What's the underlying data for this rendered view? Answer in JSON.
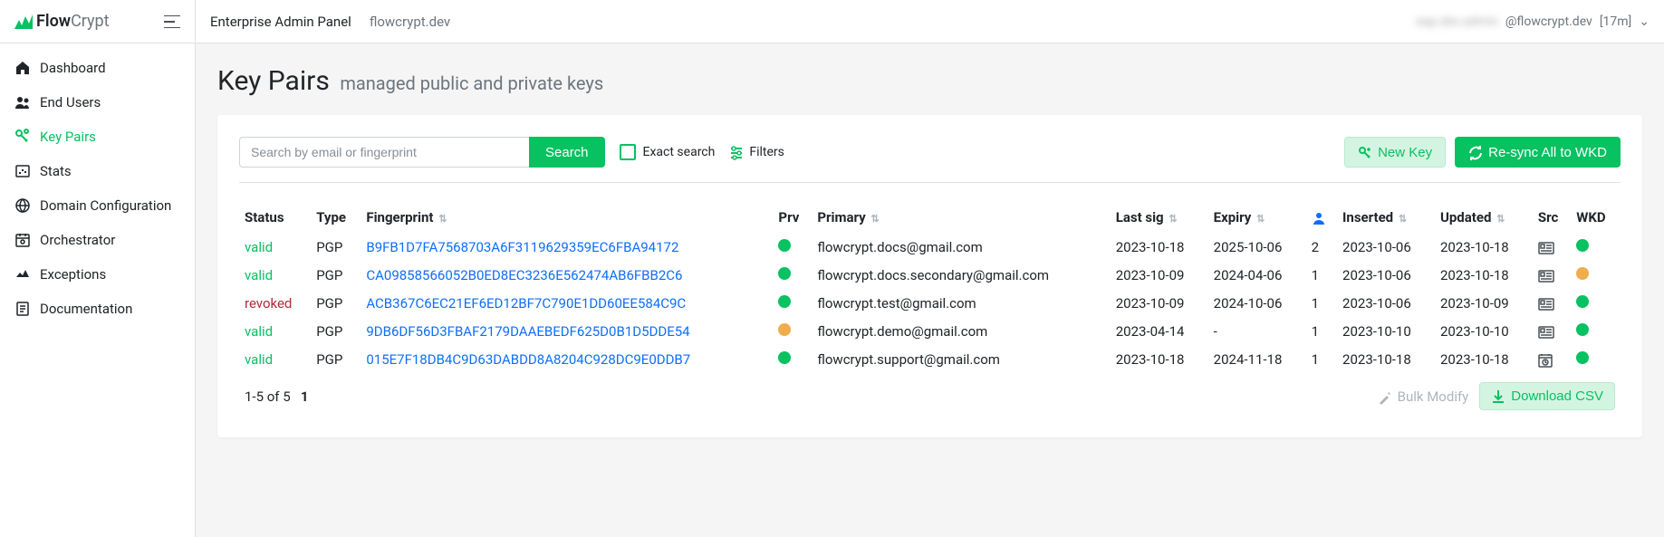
{
  "logo": {
    "flow": "Flow",
    "crypt": "Crypt"
  },
  "topbar": {
    "title": "Enterprise Admin Panel",
    "domain": "flowcrypt.dev",
    "user_prefix": "eap.dev.admin",
    "user_domain": "@flowcrypt.dev",
    "session": "[17m]"
  },
  "sidebar": {
    "items": [
      {
        "label": "Dashboard",
        "icon": "home"
      },
      {
        "label": "End Users",
        "icon": "users"
      },
      {
        "label": "Key Pairs",
        "icon": "keys",
        "active": true
      },
      {
        "label": "Stats",
        "icon": "stats"
      },
      {
        "label": "Domain Configuration",
        "icon": "globe"
      },
      {
        "label": "Orchestrator",
        "icon": "calendar"
      },
      {
        "label": "Exceptions",
        "icon": "exception"
      },
      {
        "label": "Documentation",
        "icon": "doc"
      }
    ]
  },
  "page": {
    "title": "Key Pairs",
    "subtitle": "managed public and private keys"
  },
  "toolbar": {
    "search_placeholder": "Search by email or fingerprint",
    "search_btn": "Search",
    "exact_search": "Exact search",
    "filters": "Filters",
    "new_key": "New Key",
    "resync": "Re-sync All to WKD"
  },
  "table": {
    "headers": {
      "status": "Status",
      "type": "Type",
      "fingerprint": "Fingerprint",
      "prv": "Prv",
      "primary": "Primary",
      "last_sig": "Last sig",
      "expiry": "Expiry",
      "person": "",
      "inserted": "Inserted",
      "updated": "Updated",
      "src": "Src",
      "wkd": "WKD"
    },
    "rows": [
      {
        "status": "valid",
        "status_class": "valid",
        "type": "PGP",
        "fingerprint": "B9FB1D7FA7568703A6F3119629359EC6FBA94172",
        "prv": "green",
        "primary": "flowcrypt.docs@gmail.com",
        "last_sig": "2023-10-18",
        "expiry": "2025-10-06",
        "person": "2",
        "inserted": "2023-10-06",
        "updated": "2023-10-18",
        "src": "card",
        "wkd": "green"
      },
      {
        "status": "valid",
        "status_class": "valid",
        "type": "PGP",
        "fingerprint": "CA09858566052B0ED8EC3236E562474AB6FBB2C6",
        "prv": "green",
        "primary": "flowcrypt.docs.secondary@gmail.com",
        "last_sig": "2023-10-09",
        "expiry": "2024-04-06",
        "person": "1",
        "inserted": "2023-10-06",
        "updated": "2023-10-18",
        "src": "card",
        "wkd": "orange"
      },
      {
        "status": "revoked",
        "status_class": "revoked",
        "type": "PGP",
        "fingerprint": "ACB367C6EC21EF6ED12BF7C790E1DD60EE584C9C",
        "prv": "green",
        "primary": "flowcrypt.test@gmail.com",
        "last_sig": "2023-10-09",
        "expiry": "2024-10-06",
        "person": "1",
        "inserted": "2023-10-06",
        "updated": "2023-10-09",
        "src": "card",
        "wkd": "green"
      },
      {
        "status": "valid",
        "status_class": "valid",
        "type": "PGP",
        "fingerprint": "9DB6DF56D3FBAF2179DAAEBEDF625D0B1D5DDE54",
        "prv": "orange",
        "primary": "flowcrypt.demo@gmail.com",
        "last_sig": "2023-04-14",
        "expiry": "-",
        "person": "1",
        "inserted": "2023-10-10",
        "updated": "2023-10-10",
        "src": "card",
        "wkd": "green"
      },
      {
        "status": "valid",
        "status_class": "valid",
        "type": "PGP",
        "fingerprint": "015E7F18DB4C9D63DABDD8A8204C928DC9E0DDB7",
        "prv": "green",
        "primary": "flowcrypt.support@gmail.com",
        "last_sig": "2023-10-18",
        "expiry": "2024-11-18",
        "person": "1",
        "inserted": "2023-10-18",
        "updated": "2023-10-18",
        "src": "clock",
        "wkd": "green"
      }
    ],
    "pagination": {
      "range": "1-5 of 5",
      "page": "1"
    },
    "bulk_modify": "Bulk Modify",
    "download_csv": "Download CSV"
  }
}
